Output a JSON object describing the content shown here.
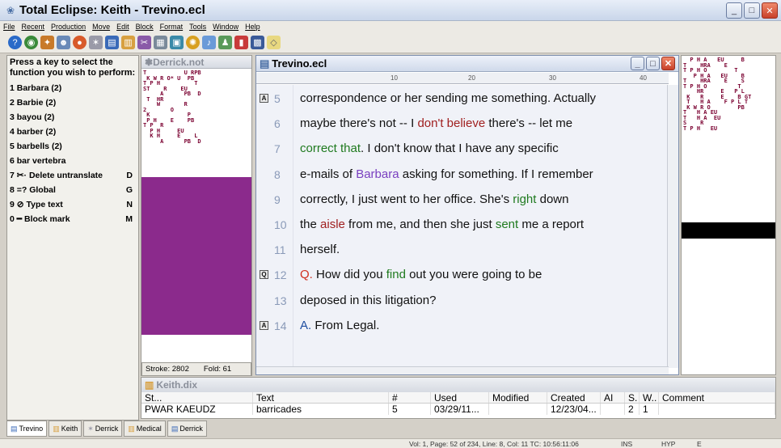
{
  "window": {
    "title": "Total Eclipse: Keith - Trevino.ecl"
  },
  "menu": [
    "File",
    "Recent",
    "Production",
    "Move",
    "Edit",
    "Block",
    "Format",
    "Tools",
    "Window",
    "Help"
  ],
  "toolbar_icons": [
    "help-icon",
    "globe-icon",
    "tools-icon",
    "people-icon",
    "ball-icon",
    "star-icon",
    "book-icon",
    "book2-icon",
    "scissors-icon",
    "printer-icon",
    "image-icon",
    "gear-icon",
    "speaker-icon",
    "person-icon",
    "chart-icon",
    "grid-icon",
    "card-icon"
  ],
  "fnpanel": {
    "header": "Press a key to select the function you wish to perform:",
    "items": [
      {
        "label": "1 Barbara  (2)",
        "key": ""
      },
      {
        "label": "2 Barbie  (2)",
        "key": ""
      },
      {
        "label": "3 bayou  (2)",
        "key": ""
      },
      {
        "label": "4 barber  (2)",
        "key": ""
      },
      {
        "label": "5 barbells  (2)",
        "key": ""
      },
      {
        "label": "6 bar vertebra",
        "key": ""
      },
      {
        "label": "7 ✂· Delete untranslate",
        "key": "D"
      },
      {
        "label": "8 =? Global",
        "key": "G"
      },
      {
        "label": "9 ⊘ Type text",
        "key": "N"
      },
      {
        "label": "0 ━ Block mark",
        "key": "M"
      }
    ]
  },
  "steno_left": {
    "title": "Derrick.not",
    "status_stroke": "Stroke: 2802",
    "status_fold": "Fold: 61"
  },
  "doc": {
    "title": "Trevino.ecl",
    "ruler": [
      "10",
      "20",
      "30",
      "40"
    ],
    "lines": [
      {
        "num": "5",
        "mark": "A",
        "parts": [
          {
            "t": "correspondence or her sending me something.  Actually",
            "c": ""
          }
        ]
      },
      {
        "num": "6",
        "mark": "",
        "parts": [
          {
            "t": "maybe there's not -- I ",
            "c": ""
          },
          {
            "t": "don't believe",
            "c": "r"
          },
          {
            "t": " there's -- let me",
            "c": ""
          }
        ]
      },
      {
        "num": "7",
        "mark": "",
        "parts": [
          {
            "t": "correct that",
            "c": "g"
          },
          {
            "t": ".  I don't know that I have any specific",
            "c": ""
          }
        ]
      },
      {
        "num": "8",
        "mark": "",
        "parts": [
          {
            "t": "e-mails of ",
            "c": ""
          },
          {
            "t": "Barbara",
            "c": "p"
          },
          {
            "t": " asking for something.  If I remember",
            "c": ""
          }
        ]
      },
      {
        "num": "9",
        "mark": "",
        "parts": [
          {
            "t": "correctly, I just went to her office.  She's ",
            "c": ""
          },
          {
            "t": "right",
            "c": "g"
          },
          {
            "t": " down",
            "c": ""
          }
        ]
      },
      {
        "num": "10",
        "mark": "",
        "parts": [
          {
            "t": "the ",
            "c": ""
          },
          {
            "t": "aisle",
            "c": "r"
          },
          {
            "t": " from me, and then she just ",
            "c": ""
          },
          {
            "t": "sent",
            "c": "g"
          },
          {
            "t": " me a report",
            "c": ""
          }
        ]
      },
      {
        "num": "11",
        "mark": "",
        "parts": [
          {
            "t": "herself.",
            "c": ""
          }
        ]
      },
      {
        "num": "12",
        "mark": "Q",
        "parts": [
          {
            "t": "        Q.",
            "c": "q"
          },
          {
            "t": "        How did you ",
            "c": ""
          },
          {
            "t": "find",
            "c": "g"
          },
          {
            "t": " out you were going to be",
            "c": ""
          }
        ]
      },
      {
        "num": "13",
        "mark": "",
        "parts": [
          {
            "t": "deposed in this litigation?",
            "c": ""
          }
        ]
      },
      {
        "num": "14",
        "mark": "A",
        "parts": [
          {
            "t": "        A.",
            "c": "b"
          },
          {
            "t": "        From Legal.",
            "c": ""
          }
        ]
      }
    ]
  },
  "dix": {
    "title": "Keith.dix",
    "columns": [
      "St...",
      "Text",
      "#",
      "Used",
      "Modified",
      "Created",
      "AI",
      "S.",
      "W..",
      "Comment"
    ],
    "row": [
      "PWAR KAEUDZ",
      "barricades",
      "5",
      "03/29/11...",
      "",
      "12/23/04...",
      "",
      "2",
      "1",
      ""
    ]
  },
  "tabs": [
    "Trevino",
    "Keith",
    "Derrick",
    "Medical",
    "Derrick"
  ],
  "status": {
    "position": "Vol: 1, Page: 52 of 234, Line: 8, Col: 11 TC: 10:56:11:06",
    "ins": "INS",
    "hyp": "HYP",
    "e": "E"
  },
  "colors": {
    "purple_band": "#8b2a8c",
    "green_text": "#1f7a1f",
    "red_text": "#a02020",
    "purple_text": "#7a40c0"
  }
}
